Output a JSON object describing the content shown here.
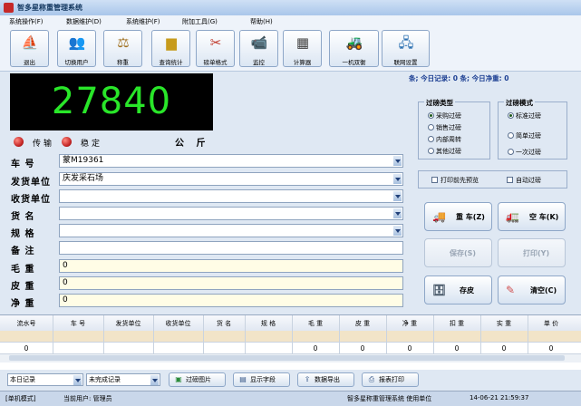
{
  "window": {
    "title": "智多星称重管理系统"
  },
  "menu": [
    "系统操作(F)",
    "数据维护(D)",
    "系统维护(F)",
    "附加工具(G)",
    "帮助(H)"
  ],
  "toolbar": [
    {
      "label": "退出",
      "icon": "exit-icon"
    },
    {
      "label": "切换用户",
      "icon": "users-icon"
    },
    {
      "label": "称重",
      "icon": "scale-icon"
    },
    {
      "label": "查询统计",
      "icon": "chart-icon"
    },
    {
      "label": "磅单格式",
      "icon": "tools-icon"
    },
    {
      "label": "监控",
      "icon": "camera-icon"
    },
    {
      "label": "计算器",
      "icon": "calculator-icon"
    },
    {
      "label": "一机双衡",
      "icon": "forklift-icon"
    },
    {
      "label": "联网设置",
      "icon": "network-icon"
    }
  ],
  "display": {
    "weight": "27840",
    "unit": "公 斤"
  },
  "stats_text": "条; 今日记录: 0 条; 今日净重: 0",
  "indicators": {
    "transfer": "传输",
    "stable": "稳定"
  },
  "form": {
    "plate": {
      "label": "车 号",
      "value": "蒙M19361"
    },
    "sender": {
      "label": "发货单位",
      "value": "庆发采石场"
    },
    "receiver": {
      "label": "收货单位",
      "value": ""
    },
    "goods": {
      "label": "货 名",
      "value": ""
    },
    "spec": {
      "label": "规 格",
      "value": ""
    },
    "remark": {
      "label": "备 注",
      "value": ""
    },
    "gross": {
      "label": "毛 重",
      "value": "0"
    },
    "tare": {
      "label": "皮 重",
      "value": "0"
    },
    "net": {
      "label": "净 重",
      "value": "0"
    }
  },
  "weigh_type": {
    "title": "过磅类型",
    "options": [
      "采购过磅",
      "销售过磅",
      "内部周转",
      "其他过磅"
    ],
    "selected": 0
  },
  "weigh_mode": {
    "title": "过磅模式",
    "options": [
      "标准过磅",
      "简单过磅",
      "一次过磅"
    ],
    "selected": 0
  },
  "checkboxes": {
    "print_preview": "打印前先预览",
    "auto_weigh": "自动过磅"
  },
  "actions": {
    "heavy": "重 车(Z)",
    "empty": "空 车(K)",
    "save": "保存(S)",
    "print": "打印(Y)",
    "store_tare": "存皮",
    "clear": "清空(C)"
  },
  "table": {
    "columns": [
      "流水号",
      "车 号",
      "发货单位",
      "收货单位",
      "货 名",
      "规 格",
      "毛 重",
      "皮 重",
      "净 重",
      "扣 重",
      "实 重",
      "单 价"
    ],
    "summary": [
      "0",
      "",
      "",
      "",
      "",
      "",
      "0",
      "0",
      "0",
      "0",
      "0",
      "0"
    ]
  },
  "bottom": {
    "range": "本日记录",
    "status_filter": "未完成记录",
    "buttons": [
      "过磅图片",
      "显示字段",
      "数据导出",
      "报表打印"
    ]
  },
  "statusbar": {
    "mode": "[单机模式]",
    "user": "当前用户: 管理员",
    "company": "智多星称重管理系统 使用单位",
    "datetime": "14-06-21 21:59:37"
  }
}
